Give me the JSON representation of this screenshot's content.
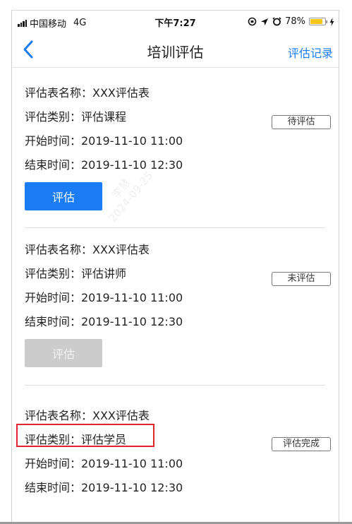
{
  "status_bar": {
    "carrier": "中国移动",
    "network": "4G",
    "time": "下午7:27",
    "battery": "78%"
  },
  "nav": {
    "title": "培训评估",
    "records_link": "评估记录"
  },
  "watermark": {
    "name": "李慧",
    "date": "2024-09-25"
  },
  "evaluations": [
    {
      "form_name": "评估表名称：XXX评估表",
      "category": "评估类别：评估课程",
      "start_time": "开始时间：2019-11-10 11:00",
      "end_time": "结束时间：2019-11-10 12:30",
      "status": "待评估",
      "action": "评估"
    },
    {
      "form_name": "评估表名称：XXX评估表",
      "category": "评估类别：评估讲师",
      "start_time": "开始时间：2019-11-10 11:00",
      "end_time": "结束时间：2019-11-10 12:30",
      "status": "未评估",
      "action": "评估"
    },
    {
      "form_name": "评估表名称：XXX评估表",
      "category": "评估类别：评估学员",
      "start_time": "开始时间：2019-11-10 11:00",
      "end_time": "结束时间：2019-11-10 12:30",
      "status": "评估完成"
    }
  ],
  "colors": {
    "accent": "#1a7cf2",
    "disabled": "#cccccc",
    "highlight": "#e0262c"
  }
}
